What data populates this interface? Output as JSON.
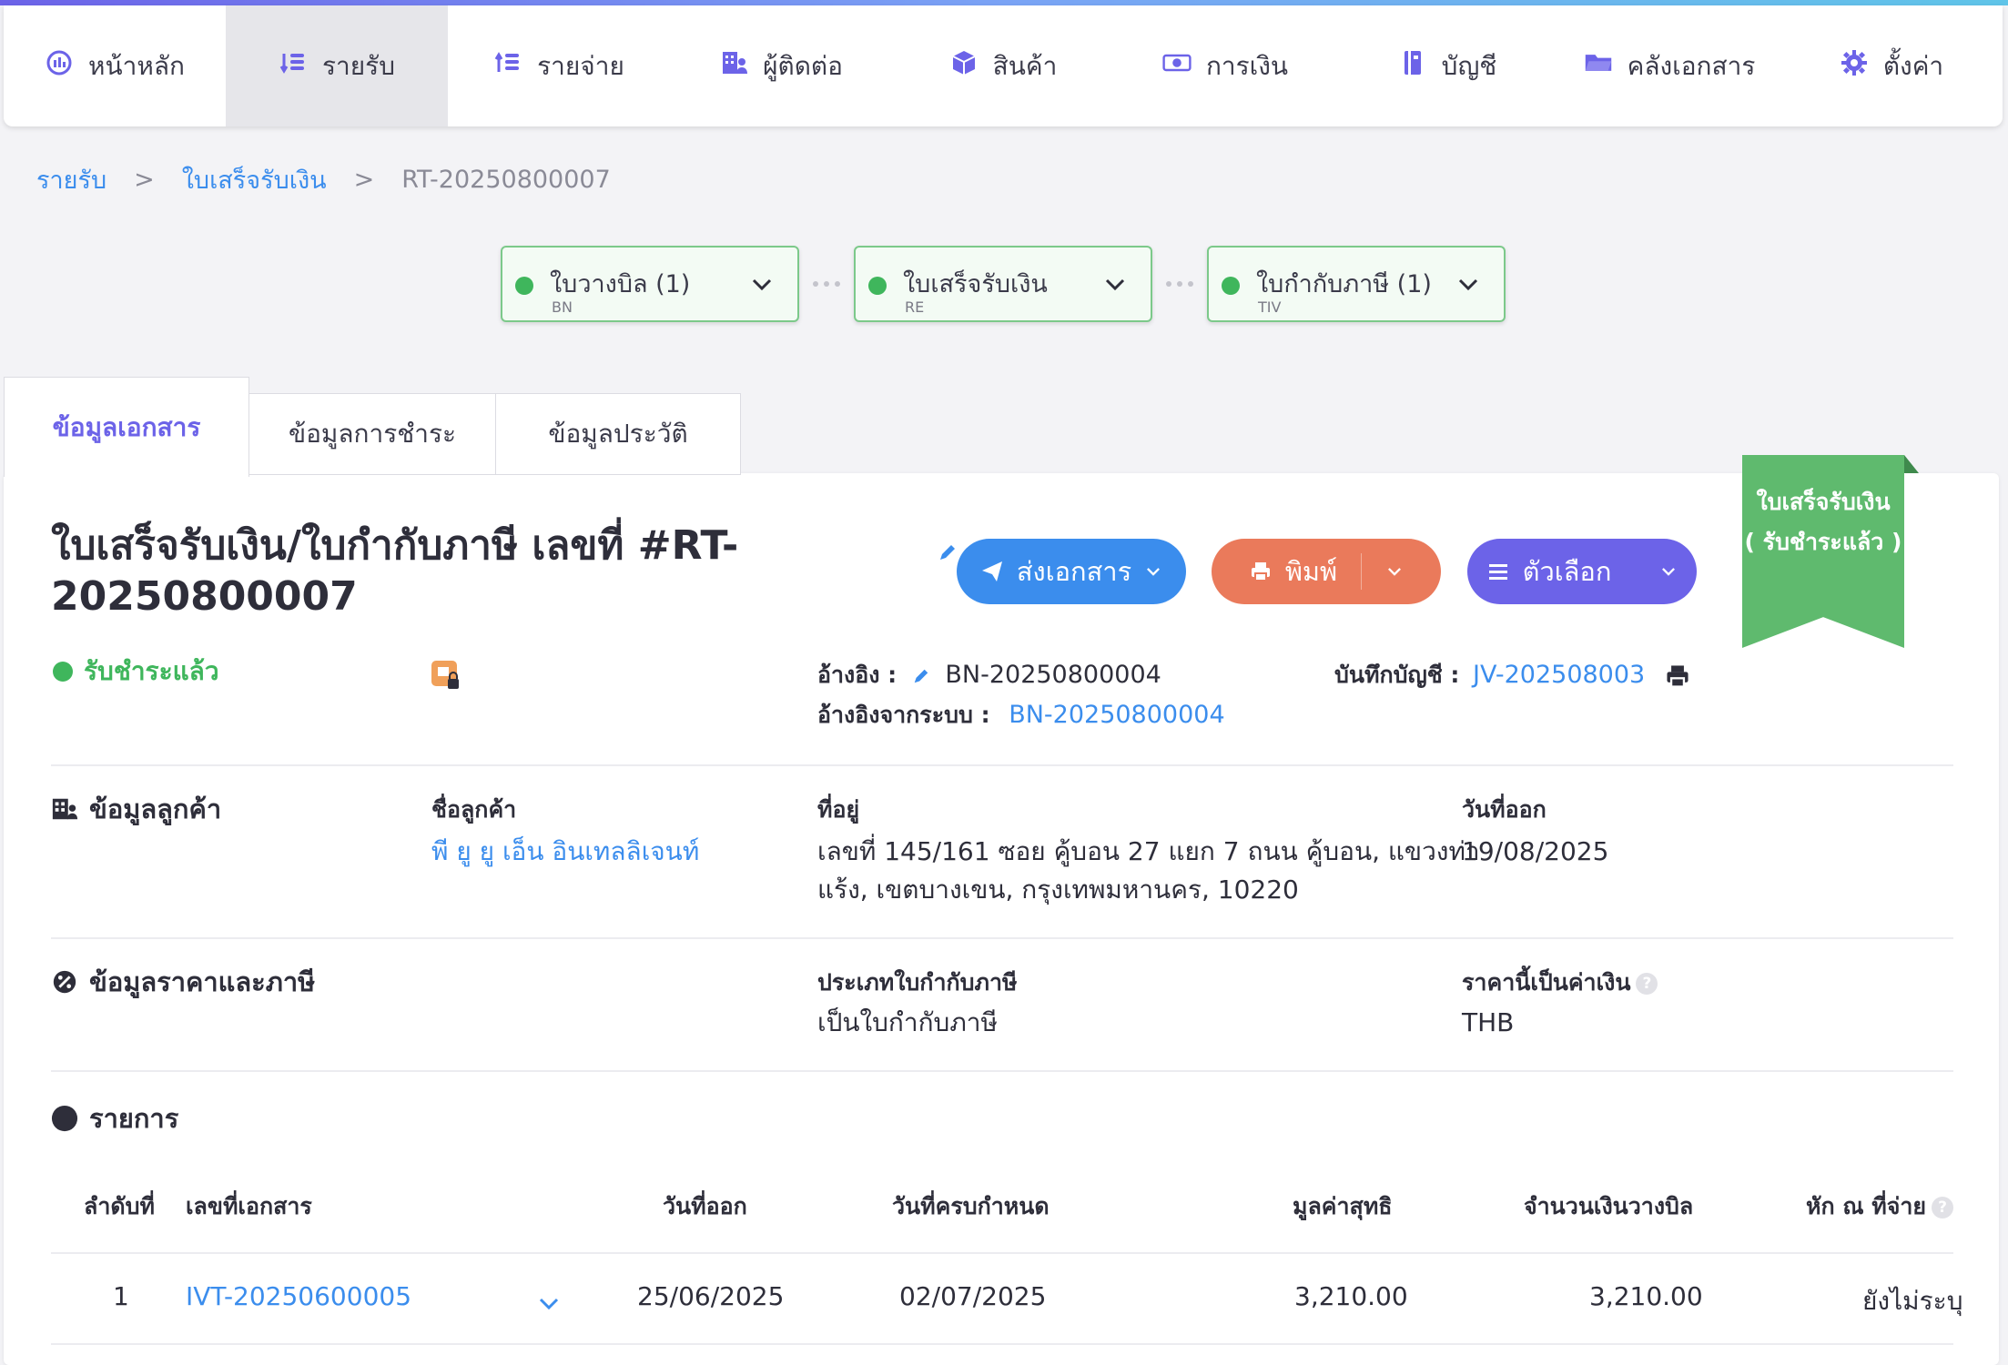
{
  "nav": {
    "items": [
      {
        "label": "หน้าหลัก",
        "icon": "dashboard-icon"
      },
      {
        "label": "รายรับ",
        "icon": "income-icon"
      },
      {
        "label": "รายจ่าย",
        "icon": "expense-icon"
      },
      {
        "label": "ผู้ติดต่อ",
        "icon": "contacts-icon"
      },
      {
        "label": "สินค้า",
        "icon": "product-box-icon"
      },
      {
        "label": "การเงิน",
        "icon": "money-icon"
      },
      {
        "label": "บัญชี",
        "icon": "ledger-icon"
      },
      {
        "label": "คลังเอกสาร",
        "icon": "folder-icon"
      },
      {
        "label": "ตั้งค่า",
        "icon": "gear-icon"
      }
    ],
    "active_index": 1
  },
  "breadcrumb": {
    "level1": "รายรับ",
    "sep": ">",
    "level2": "ใบเสร็จรับเงิน",
    "current": "RT-20250800007"
  },
  "flow": [
    {
      "title": "ใบวางบิล (1)",
      "code": "BN"
    },
    {
      "title": "ใบเสร็จรับเงิน",
      "code": "RE"
    },
    {
      "title": "ใบกำกับภาษี (1)",
      "code": "TIV"
    }
  ],
  "tabs": [
    "ข้อมูลเอกสาร",
    "ข้อมูลการชำระ",
    "ข้อมูลประวัติ"
  ],
  "doc": {
    "title": "ใบเสร็จรับเงิน/ใบกำกับภาษี เลขที่ #RT-20250800007",
    "status": "รับชำระแล้ว",
    "ribbon_line1": "ใบเสร็จรับเงิน",
    "ribbon_line2": "( รับชำระแล้ว )"
  },
  "actions": {
    "send": "ส่งเอกสาร",
    "print": "พิมพ์",
    "options": "ตัวเลือก"
  },
  "refs": {
    "ref_label": "อ้างอิง :",
    "ref_value": "BN-20250800004",
    "sys_ref_label": "อ้างอิงจากระบบ :",
    "sys_ref_value": "BN-20250800004",
    "journal_label": "บันทึกบัญชี :",
    "journal_value": "JV-202508003"
  },
  "customer": {
    "section": "ข้อมูลลูกค้า",
    "name_label": "ชื่อลูกค้า",
    "name": "พี ยู ยู เอ็น อินเทลลิเจนท์",
    "address_label": "ที่อยู่",
    "address_line1": "เลขที่ 145/161 ซอย คู้บอน 27 แยก 7 ถนน คู้บอน, แขวงท่า",
    "address_line2": "แร้ง, เขตบางเขน, กรุงเทพมหานคร, 10220",
    "date_label": "วันที่ออก",
    "date": "19/08/2025"
  },
  "pricing": {
    "section": "ข้อมูลราคาและภาษี",
    "tax_type_label": "ประเภทใบกำกับภาษี",
    "tax_type": "เป็นใบกำกับภาษี",
    "currency_label": "ราคานี้เป็นค่าเงิน",
    "currency": "THB",
    "help": "?"
  },
  "items": {
    "section": "รายการ",
    "headers": [
      "ลำดับที่",
      "เลขที่เอกสาร",
      "วันที่ออก",
      "วันที่ครบกำหนด",
      "มูลค่าสุทธิ",
      "จำนวนเงินวางบิล",
      "หัก ณ ที่จ่าย"
    ],
    "rows": [
      {
        "no": "1",
        "doc": "IVT-20250600005",
        "issue": "25/06/2025",
        "due": "02/07/2025",
        "net": "3,210.00",
        "billed": "3,210.00",
        "wht": "ยังไม่ระบุ"
      }
    ]
  },
  "colors": {
    "accent": "#6c63e8",
    "link": "#3b8ded",
    "success": "#3fb65c",
    "print": "#ea7a5b",
    "send": "#3b8ded"
  }
}
